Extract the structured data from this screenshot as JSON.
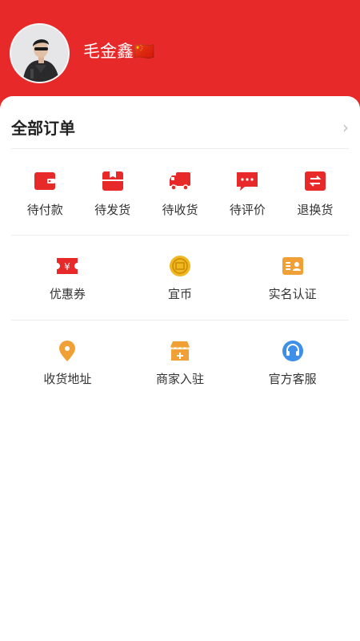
{
  "profile": {
    "name": "毛金鑫🇨🇳"
  },
  "orders": {
    "title": "全部订单",
    "chevron": "›",
    "items": [
      {
        "label": "待付款",
        "icon": "wallet-icon"
      },
      {
        "label": "待发货",
        "icon": "package-icon"
      },
      {
        "label": "待收货",
        "icon": "truck-icon"
      },
      {
        "label": "待评价",
        "icon": "comment-icon"
      },
      {
        "label": "退换货",
        "icon": "exchange-icon"
      }
    ]
  },
  "services_row1": [
    {
      "label": "优惠券",
      "icon": "coupon-icon"
    },
    {
      "label": "宜币",
      "icon": "coin-icon"
    },
    {
      "label": "实名认证",
      "icon": "id-card-icon"
    }
  ],
  "services_row2": [
    {
      "label": "收货地址",
      "icon": "location-pin-icon"
    },
    {
      "label": "商家入驻",
      "icon": "shop-icon"
    },
    {
      "label": "官方客服",
      "icon": "headset-icon"
    }
  ],
  "colors": {
    "header": "#e8292a",
    "icon_red": "#e8292a",
    "icon_orange": "#f0a035",
    "icon_blue": "#3d8fe8",
    "icon_gold": "#f1b720"
  }
}
